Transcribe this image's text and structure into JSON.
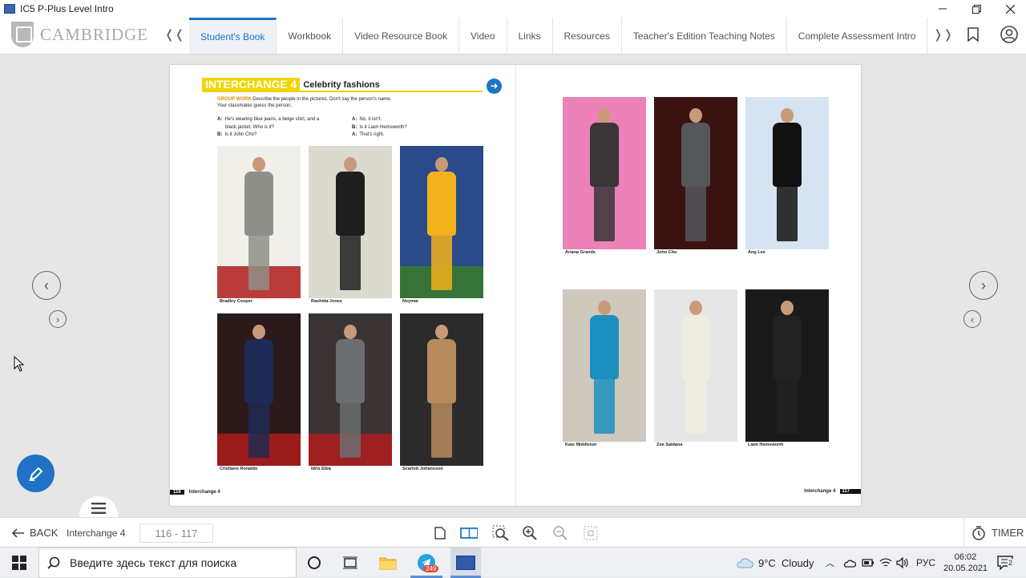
{
  "window": {
    "title": "IC5 P-Plus Level Intro"
  },
  "logo": {
    "text": "CAMBRIDGE"
  },
  "tabs": [
    "Student's Book",
    "Workbook",
    "Video Resource Book",
    "Video",
    "Links",
    "Resources",
    "Teacher's Edition Teaching Notes",
    "Complete Assessment Intro"
  ],
  "page": {
    "heading_tag": "INTERCHANGE 4",
    "heading_title": "Celebrity fashions",
    "group_work_label": "GROUP WORK",
    "instructions": "Describe the people in the pictures. Don't say the person's name.",
    "instructions2": "Your classmates guess the person.",
    "dialog_left": [
      {
        "speaker": "A:",
        "text": "He's wearing blue jeans, a beige shirt, and a"
      },
      {
        "speaker": "",
        "text": "black jacket. Who is it?"
      },
      {
        "speaker": "B:",
        "text": "Is it John Cho?"
      }
    ],
    "dialog_right": [
      {
        "speaker": "A:",
        "text": "No, it isn't."
      },
      {
        "speaker": "B:",
        "text": "Is it Liam Hemsworth?"
      },
      {
        "speaker": "A:",
        "text": "That's right."
      }
    ],
    "left_page_number": "116",
    "right_page_number": "117",
    "footer_label": "Interchange 4"
  },
  "photos": [
    {
      "name": "Bradley Cooper",
      "bg": "#f1efea",
      "cloth": "#8f8f8a"
    },
    {
      "name": "Rashida Jones",
      "bg": "#dcd9cf",
      "cloth": "#1f1f1f"
    },
    {
      "name": "Neymar",
      "bg": "#2a4a8a",
      "cloth": "#f2b21c"
    },
    {
      "name": "Cristiano Ronaldo",
      "bg": "#2b1a1a",
      "cloth": "#1e2a55"
    },
    {
      "name": "Idris Elba",
      "bg": "#3a3334",
      "cloth": "#6b6d70"
    },
    {
      "name": "Scarlett Johansson",
      "bg": "#2b2b2b",
      "cloth": "#b68b5c"
    },
    {
      "name": "Ariana Grande",
      "bg": "#ec82b8",
      "cloth": "#3a3537"
    },
    {
      "name": "John Cho",
      "bg": "#3b1212",
      "cloth": "#55575b"
    },
    {
      "name": "Ang Lee",
      "bg": "#d6e3f0",
      "cloth": "#111111"
    },
    {
      "name": "Kate Middleton",
      "bg": "#cfc8bc",
      "cloth": "#1d8fbf"
    },
    {
      "name": "Zoe Saldana",
      "bg": "#e6e6e6",
      "cloth": "#efece2"
    },
    {
      "name": "Liam Hemsworth",
      "bg": "#1a1a1a",
      "cloth": "#222222"
    }
  ],
  "bottom": {
    "back_label": "BACK",
    "unit_label": "Interchange 4",
    "page_range": "116 - 117",
    "timer_label": "TIMER"
  },
  "taskbar": {
    "search_placeholder": "Введите здесь текст для поиска",
    "telegram_badge": "249",
    "weather": "9°C  Cloudy",
    "lang": "РУС",
    "time": "06:02",
    "date": "20.05.2021",
    "notif_count": "2"
  },
  "colors": {
    "accent": "#1c73c6",
    "heading_yellow": "#f2d500"
  }
}
